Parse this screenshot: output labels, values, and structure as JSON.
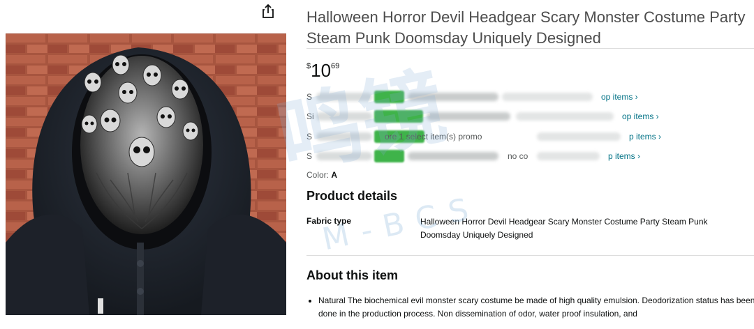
{
  "product": {
    "title": "Halloween Horror Devil Headgear Scary Monster Costume Party Steam Punk Doomsday Uniquely Designed",
    "price_symbol": "$",
    "price_whole": "10",
    "price_fraction": "69"
  },
  "promotions": [
    {
      "lead": "S",
      "tail": "",
      "link": "op items ›"
    },
    {
      "lead": "Si",
      "tail": "",
      "link": "op items ›"
    },
    {
      "lead": "S",
      "tail": "ore 1 select item(s) promo",
      "link": "p items ›"
    },
    {
      "lead": "S",
      "tail": "no co",
      "link": "p items ›"
    }
  ],
  "color": {
    "label": "Color:",
    "value": "A"
  },
  "product_details": {
    "heading": "Product details",
    "rows": [
      {
        "label": "Fabric type",
        "value": "Halloween Horror Devil Headgear Scary Monster Costume Party Steam Punk Doomsday Uniquely Designed"
      }
    ]
  },
  "about": {
    "heading": "About this item",
    "bullets": [
      "Natural The biochemical evil monster scary costume be made of high quality emulsion. Deodorization status has been done in the production process. Non dissemination of odor, water proof insulation, and"
    ]
  },
  "watermark": {
    "main": "鸣镜",
    "sub": "M-BCS"
  },
  "icons": {
    "share": "share-icon"
  },
  "colors": {
    "link": "#007185",
    "badge": "#3fb34a",
    "title": "#4d4d4d"
  }
}
